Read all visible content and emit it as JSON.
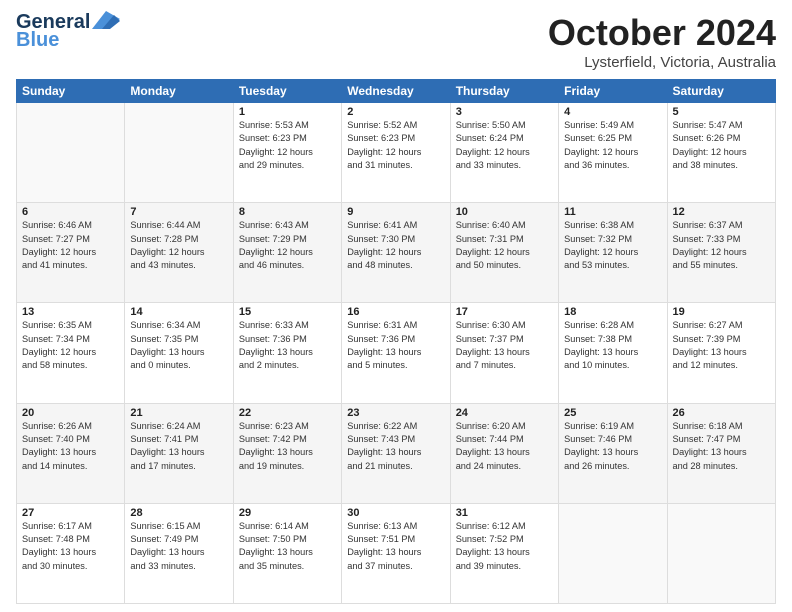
{
  "header": {
    "logo_line1": "General",
    "logo_line2": "Blue",
    "month": "October 2024",
    "location": "Lysterfield, Victoria, Australia"
  },
  "days_of_week": [
    "Sunday",
    "Monday",
    "Tuesday",
    "Wednesday",
    "Thursday",
    "Friday",
    "Saturday"
  ],
  "weeks": [
    [
      {
        "day": "",
        "info": ""
      },
      {
        "day": "",
        "info": ""
      },
      {
        "day": "1",
        "info": "Sunrise: 5:53 AM\nSunset: 6:23 PM\nDaylight: 12 hours\nand 29 minutes."
      },
      {
        "day": "2",
        "info": "Sunrise: 5:52 AM\nSunset: 6:23 PM\nDaylight: 12 hours\nand 31 minutes."
      },
      {
        "day": "3",
        "info": "Sunrise: 5:50 AM\nSunset: 6:24 PM\nDaylight: 12 hours\nand 33 minutes."
      },
      {
        "day": "4",
        "info": "Sunrise: 5:49 AM\nSunset: 6:25 PM\nDaylight: 12 hours\nand 36 minutes."
      },
      {
        "day": "5",
        "info": "Sunrise: 5:47 AM\nSunset: 6:26 PM\nDaylight: 12 hours\nand 38 minutes."
      }
    ],
    [
      {
        "day": "6",
        "info": "Sunrise: 6:46 AM\nSunset: 7:27 PM\nDaylight: 12 hours\nand 41 minutes."
      },
      {
        "day": "7",
        "info": "Sunrise: 6:44 AM\nSunset: 7:28 PM\nDaylight: 12 hours\nand 43 minutes."
      },
      {
        "day": "8",
        "info": "Sunrise: 6:43 AM\nSunset: 7:29 PM\nDaylight: 12 hours\nand 46 minutes."
      },
      {
        "day": "9",
        "info": "Sunrise: 6:41 AM\nSunset: 7:30 PM\nDaylight: 12 hours\nand 48 minutes."
      },
      {
        "day": "10",
        "info": "Sunrise: 6:40 AM\nSunset: 7:31 PM\nDaylight: 12 hours\nand 50 minutes."
      },
      {
        "day": "11",
        "info": "Sunrise: 6:38 AM\nSunset: 7:32 PM\nDaylight: 12 hours\nand 53 minutes."
      },
      {
        "day": "12",
        "info": "Sunrise: 6:37 AM\nSunset: 7:33 PM\nDaylight: 12 hours\nand 55 minutes."
      }
    ],
    [
      {
        "day": "13",
        "info": "Sunrise: 6:35 AM\nSunset: 7:34 PM\nDaylight: 12 hours\nand 58 minutes."
      },
      {
        "day": "14",
        "info": "Sunrise: 6:34 AM\nSunset: 7:35 PM\nDaylight: 13 hours\nand 0 minutes."
      },
      {
        "day": "15",
        "info": "Sunrise: 6:33 AM\nSunset: 7:36 PM\nDaylight: 13 hours\nand 2 minutes."
      },
      {
        "day": "16",
        "info": "Sunrise: 6:31 AM\nSunset: 7:36 PM\nDaylight: 13 hours\nand 5 minutes."
      },
      {
        "day": "17",
        "info": "Sunrise: 6:30 AM\nSunset: 7:37 PM\nDaylight: 13 hours\nand 7 minutes."
      },
      {
        "day": "18",
        "info": "Sunrise: 6:28 AM\nSunset: 7:38 PM\nDaylight: 13 hours\nand 10 minutes."
      },
      {
        "day": "19",
        "info": "Sunrise: 6:27 AM\nSunset: 7:39 PM\nDaylight: 13 hours\nand 12 minutes."
      }
    ],
    [
      {
        "day": "20",
        "info": "Sunrise: 6:26 AM\nSunset: 7:40 PM\nDaylight: 13 hours\nand 14 minutes."
      },
      {
        "day": "21",
        "info": "Sunrise: 6:24 AM\nSunset: 7:41 PM\nDaylight: 13 hours\nand 17 minutes."
      },
      {
        "day": "22",
        "info": "Sunrise: 6:23 AM\nSunset: 7:42 PM\nDaylight: 13 hours\nand 19 minutes."
      },
      {
        "day": "23",
        "info": "Sunrise: 6:22 AM\nSunset: 7:43 PM\nDaylight: 13 hours\nand 21 minutes."
      },
      {
        "day": "24",
        "info": "Sunrise: 6:20 AM\nSunset: 7:44 PM\nDaylight: 13 hours\nand 24 minutes."
      },
      {
        "day": "25",
        "info": "Sunrise: 6:19 AM\nSunset: 7:46 PM\nDaylight: 13 hours\nand 26 minutes."
      },
      {
        "day": "26",
        "info": "Sunrise: 6:18 AM\nSunset: 7:47 PM\nDaylight: 13 hours\nand 28 minutes."
      }
    ],
    [
      {
        "day": "27",
        "info": "Sunrise: 6:17 AM\nSunset: 7:48 PM\nDaylight: 13 hours\nand 30 minutes."
      },
      {
        "day": "28",
        "info": "Sunrise: 6:15 AM\nSunset: 7:49 PM\nDaylight: 13 hours\nand 33 minutes."
      },
      {
        "day": "29",
        "info": "Sunrise: 6:14 AM\nSunset: 7:50 PM\nDaylight: 13 hours\nand 35 minutes."
      },
      {
        "day": "30",
        "info": "Sunrise: 6:13 AM\nSunset: 7:51 PM\nDaylight: 13 hours\nand 37 minutes."
      },
      {
        "day": "31",
        "info": "Sunrise: 6:12 AM\nSunset: 7:52 PM\nDaylight: 13 hours\nand 39 minutes."
      },
      {
        "day": "",
        "info": ""
      },
      {
        "day": "",
        "info": ""
      }
    ]
  ]
}
